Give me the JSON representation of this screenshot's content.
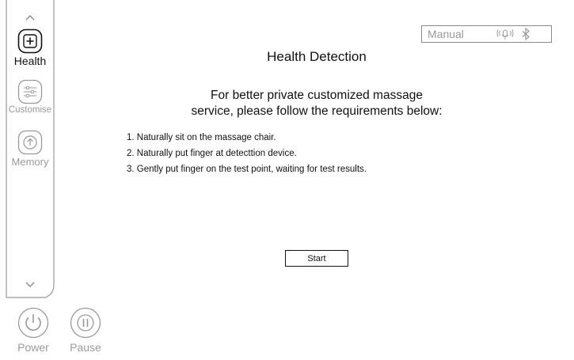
{
  "sidebar": {
    "items": [
      {
        "label": "Health",
        "icon": "health-plus-icon",
        "active": true
      },
      {
        "label": "Customise",
        "icon": "sliders-icon",
        "active": false
      },
      {
        "label": "Memory",
        "icon": "memory-upload-icon",
        "active": false
      }
    ],
    "scroll_up_glyph": "^",
    "scroll_down_glyph": "⌄"
  },
  "controls": {
    "power_label": "Power",
    "pause_label": "Pause"
  },
  "status_bar": {
    "mode": "Manual",
    "icons": [
      "voice-icon",
      "bluetooth-icon"
    ]
  },
  "main": {
    "title": "Health Detection",
    "intro_line1": "For better private customized massage",
    "intro_line2": "service, please follow the requirements below:",
    "steps": [
      "1. Naturally sit on the massage chair.",
      "2. Naturally put finger at detecttion device.",
      "3. Gently put finger on the test point, waiting for test results."
    ],
    "start_label": "Start"
  },
  "colors": {
    "active_text": "#111111",
    "inactive_text": "#9a9a9a",
    "border": "#8a8a8a"
  }
}
